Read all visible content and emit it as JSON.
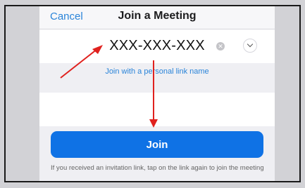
{
  "nav": {
    "cancel_label": "Cancel",
    "title": "Join a Meeting"
  },
  "meeting_id": {
    "value": "XXX-XXX-XXX",
    "clear_icon": "clear-x-icon",
    "dropdown_icon": "chevron-down-icon"
  },
  "personal_link": {
    "label": "Join with a personal link name"
  },
  "join": {
    "label": "Join"
  },
  "hint": {
    "text": "If you received an invitation link, tap on the link again to join the meeting"
  },
  "colors": {
    "accent": "#0f72e5",
    "link": "#2a84d9",
    "annotation_arrow": "#e0211e"
  }
}
